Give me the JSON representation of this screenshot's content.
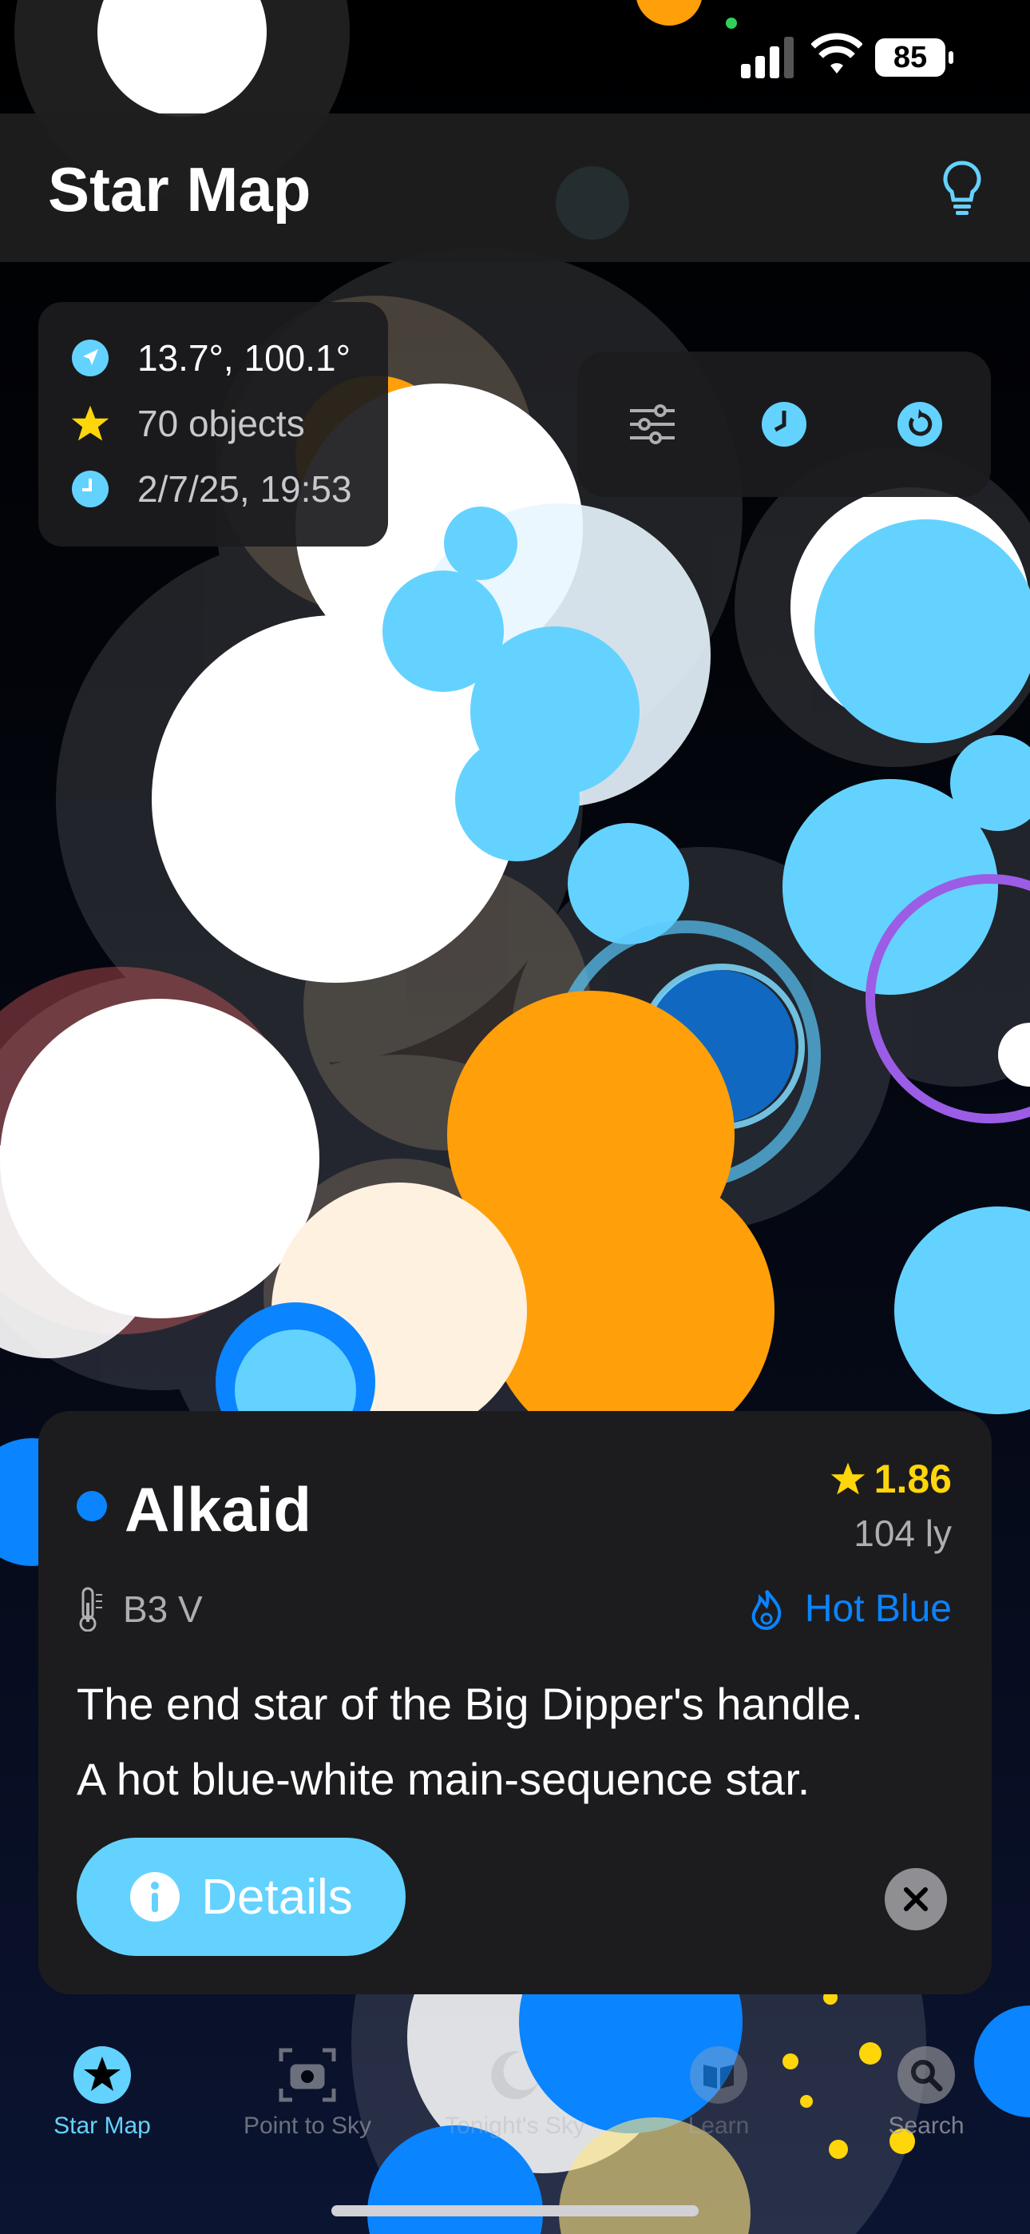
{
  "status_bar": {
    "battery": "85",
    "icons": [
      "cellular-signal-icon",
      "wifi-icon",
      "battery-icon"
    ]
  },
  "header": {
    "title": "Star Map",
    "action_icon": "lightbulb-icon"
  },
  "info_panel": {
    "coordinates": "13.7°, 100.1°",
    "object_count": "70 objects",
    "datetime": "2/7/25, 19:53",
    "icons": [
      "location-arrow-icon",
      "star-icon",
      "clock-icon"
    ]
  },
  "controls": {
    "icons": [
      "sliders-icon",
      "clock-icon",
      "reset-icon"
    ]
  },
  "star_detail": {
    "name": "Alkaid",
    "magnitude": "1.86",
    "distance": "104 ly",
    "spectral_class": "B3 V",
    "temperature_label": "Hot Blue",
    "description_line1": "The end star of the Big Dipper's handle.",
    "description_line2": "A hot blue-white main-sequence star.",
    "details_button": "Details",
    "colors": {
      "star_dot": "#0a84ff",
      "magnitude": "#ffd60a",
      "button": "#64d2ff"
    }
  },
  "tab_bar": {
    "tabs": [
      {
        "label": "Star Map",
        "icon": "star-circle-icon",
        "active": true
      },
      {
        "label": "Point to Sky",
        "icon": "camera-icon",
        "active": false
      },
      {
        "label": "Tonight's Sky",
        "icon": "moon-icon",
        "active": false
      },
      {
        "label": "Learn",
        "icon": "book-icon",
        "active": false
      },
      {
        "label": "Search",
        "icon": "search-icon",
        "active": false
      }
    ],
    "active_color": "#64d2ff"
  }
}
